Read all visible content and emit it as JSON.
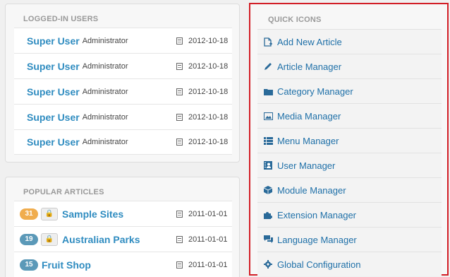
{
  "logged_in": {
    "title": "LOGGED-IN USERS",
    "rows": [
      {
        "name": "Super User",
        "role": "Administrator",
        "date": "2012-10-18"
      },
      {
        "name": "Super User",
        "role": "Administrator",
        "date": "2012-10-18"
      },
      {
        "name": "Super User",
        "role": "Administrator",
        "date": "2012-10-18"
      },
      {
        "name": "Super User",
        "role": "Administrator",
        "date": "2012-10-18"
      },
      {
        "name": "Super User",
        "role": "Administrator",
        "date": "2012-10-18"
      }
    ]
  },
  "popular": {
    "title": "POPULAR ARTICLES",
    "rows": [
      {
        "hits": "31",
        "badge_color": "#f0ad4e",
        "title": "Sample Sites",
        "date": "2011-01-01"
      },
      {
        "hits": "19",
        "badge_color": "#5b99b8",
        "title": "Australian Parks",
        "date": "2011-01-01"
      },
      {
        "hits": "15",
        "badge_color": "#5b99b8",
        "title": "Fruit Shop",
        "date": "2011-01-01"
      }
    ]
  },
  "quick_icons": {
    "title": "QUICK ICONS",
    "items": [
      {
        "label": "Add New Article",
        "icon": "new-article-icon"
      },
      {
        "label": "Article Manager",
        "icon": "pencil-icon"
      },
      {
        "label": "Category Manager",
        "icon": "folder-icon"
      },
      {
        "label": "Media Manager",
        "icon": "image-icon"
      },
      {
        "label": "Menu Manager",
        "icon": "list-icon"
      },
      {
        "label": "User Manager",
        "icon": "user-icon"
      },
      {
        "label": "Module Manager",
        "icon": "cube-icon"
      },
      {
        "label": "Extension Manager",
        "icon": "puzzle-icon"
      },
      {
        "label": "Language Manager",
        "icon": "comments-icon"
      },
      {
        "label": "Global Configuration",
        "icon": "cog-icon"
      }
    ]
  },
  "colors": {
    "link": "#2f8cc0",
    "highlight_border": "#d21e26"
  }
}
